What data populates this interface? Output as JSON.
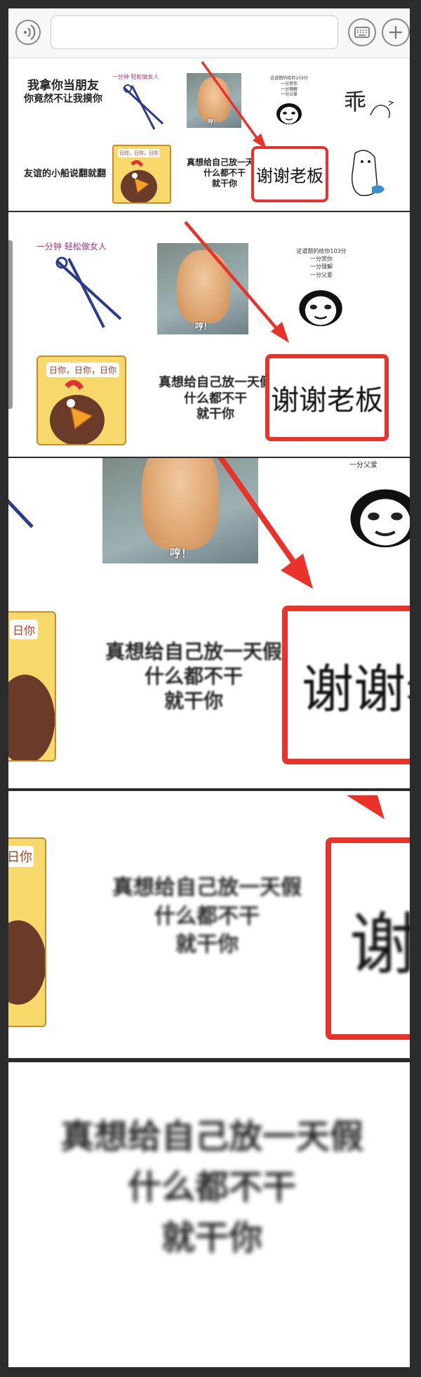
{
  "toolbar": {
    "voice_icon": "voice-icon",
    "keyboard_icon": "keyboard-icon",
    "add_icon": "plus-icon",
    "input_value": ""
  },
  "stickers": {
    "friend_line1": "我拿你当朋友",
    "friend_line2": "你竟然不让我摸你",
    "scissors_caption": "一分钟  轻松做女人",
    "cat_caption": "哼！",
    "panda_line1": "这道题的给你103分",
    "panda_line2": "一分赏你",
    "panda_line3": "一分理解",
    "panda_line4": "一分父爱",
    "guai": "乖",
    "friendship_boat": "友谊的小船说翻就翻",
    "chick_bubble": "日你，日你，日你",
    "chick_bubble_short": "日你",
    "vacation_line1": "真想给自己放一天假",
    "vacation_line2": "什么都不干",
    "vacation_line3": "就干你",
    "thanks_boss": "谢谢老板",
    "thanks_partial1": "谢谢老",
    "thanks_partial2": "谢"
  },
  "colors": {
    "highlight_red": "#e8322a",
    "panel_bg": "#f4f4f6",
    "frame": "#2c2c2c"
  }
}
